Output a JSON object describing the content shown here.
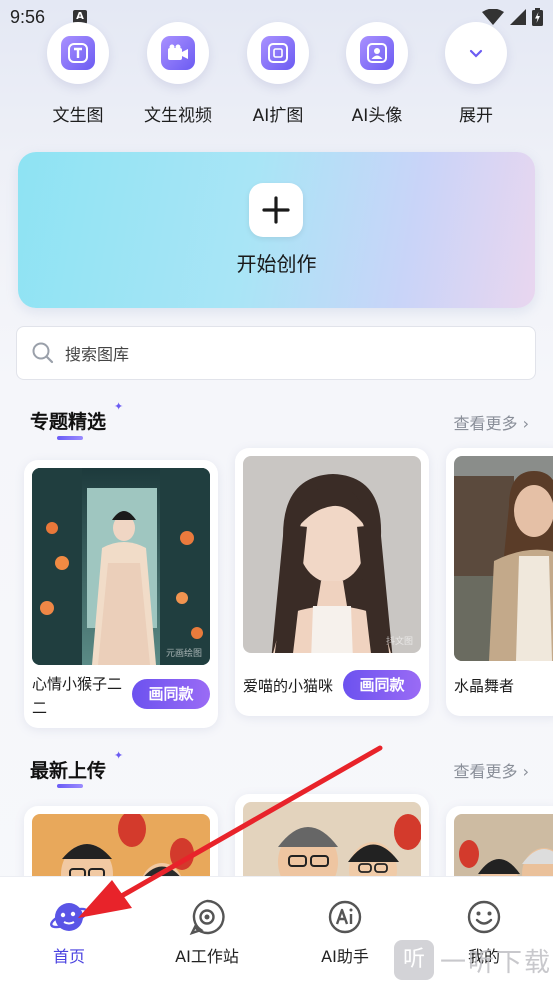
{
  "status_bar": {
    "time": "9:56",
    "notif_badge": "A"
  },
  "tools": [
    {
      "label": "文生图",
      "icon": "text-to-image-icon"
    },
    {
      "label": "文生视频",
      "icon": "text-to-video-icon"
    },
    {
      "label": "AI扩图",
      "icon": "ai-expand-icon"
    },
    {
      "label": "AI头像",
      "icon": "ai-avatar-icon"
    },
    {
      "label": "展开",
      "icon": "chevron-down-icon"
    }
  ],
  "create_banner": {
    "title": "开始创作"
  },
  "search": {
    "placeholder": "搜索图库"
  },
  "featured": {
    "title": "专题精选",
    "more": "查看更多",
    "cards": [
      {
        "caption": "心情小猴子二二",
        "button": "画同款",
        "watermark": "元画绘图"
      },
      {
        "caption": "爱喵的小猫咪",
        "button": "画同款",
        "watermark": "抖文图"
      },
      {
        "caption": "水晶舞者"
      }
    ]
  },
  "latest": {
    "title": "最新上传",
    "more": "查看更多"
  },
  "bottom_nav": [
    {
      "label": "首页",
      "active": true
    },
    {
      "label": "AI工作站",
      "active": false
    },
    {
      "label": "AI助手",
      "active": false
    },
    {
      "label": "我的",
      "active": false
    }
  ],
  "watermark": {
    "glyph": "听",
    "text": "一听下载"
  },
  "colors": {
    "accent": "#6b5cf2",
    "nav_active": "#4b43e0",
    "annotation_arrow": "#e8232a"
  }
}
